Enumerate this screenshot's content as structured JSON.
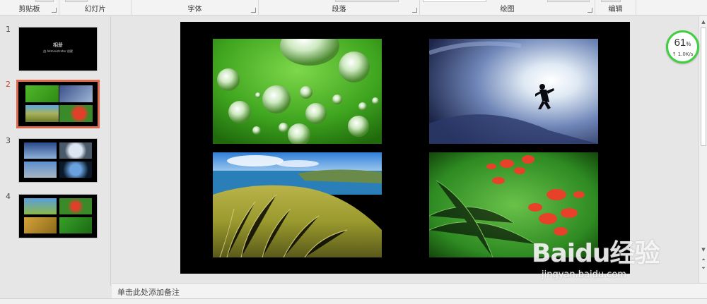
{
  "ribbon": {
    "groups": [
      {
        "label": "剪贴板"
      },
      {
        "label": "幻灯片"
      },
      {
        "label": "字体"
      },
      {
        "label": "段落"
      },
      {
        "label": "绘图"
      },
      {
        "label": "编辑"
      }
    ]
  },
  "thumbnails": [
    {
      "number": "1",
      "title": "相册",
      "subtitle": "由 Administrator 创建",
      "active": false
    },
    {
      "number": "2",
      "active": true
    },
    {
      "number": "3",
      "active": false
    },
    {
      "number": "4",
      "active": false
    }
  ],
  "notes": {
    "placeholder": "单击此处添加备注"
  },
  "speed_widget": {
    "percent": "61",
    "unit": "%",
    "rate": "1.0K/s"
  },
  "watermark": {
    "logo_text": "Baidu经验",
    "url": "jingyan.baidu.com"
  },
  "colors": {
    "accent": "#d24726",
    "active_thumb_border": "#e06a4e",
    "speed_ring": "#3fcf3f"
  }
}
